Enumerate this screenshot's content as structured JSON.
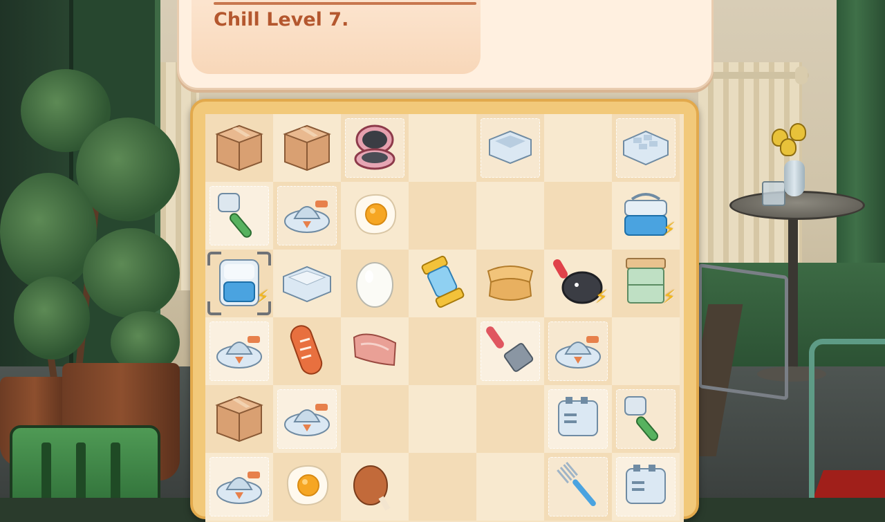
{
  "dialog": {
    "text": "Chill Level 7."
  },
  "board": {
    "rows": [
      [
        {
          "item": "cardboard-box",
          "icon": "box-icon"
        },
        {
          "item": "cardboard-box",
          "icon": "box-icon"
        },
        {
          "item": "waffle-maker",
          "icon": "waffle-maker-icon",
          "bubble": true
        },
        {
          "item": "empty"
        },
        {
          "item": "ice-tray",
          "icon": "ice-tray-icon",
          "bubble": true
        },
        {
          "item": "empty"
        },
        {
          "item": "ice-cube-tray",
          "icon": "ice-cube-tray-icon",
          "bubble": true
        }
      ],
      [
        {
          "item": "meat-tenderizer",
          "icon": "mallet-icon",
          "bubble": true
        },
        {
          "item": "juicer",
          "icon": "juicer-icon",
          "bubble": true
        },
        {
          "item": "fried-egg",
          "icon": "fried-egg-icon"
        },
        {
          "item": "empty"
        },
        {
          "item": "empty"
        },
        {
          "item": "empty"
        },
        {
          "item": "cooler-box",
          "icon": "cooler-icon",
          "energy": true
        }
      ],
      [
        {
          "item": "mini-fridge",
          "icon": "mini-fridge-icon",
          "energy": true,
          "selected": true
        },
        {
          "item": "container",
          "icon": "container-icon"
        },
        {
          "item": "egg",
          "icon": "egg-icon"
        },
        {
          "item": "blender-jar",
          "icon": "blender-jar-icon"
        },
        {
          "item": "crepe",
          "icon": "crepe-icon"
        },
        {
          "item": "frying-pan",
          "icon": "frying-pan-icon",
          "energy": true
        },
        {
          "item": "cabinet",
          "icon": "cabinet-icon",
          "energy": true
        }
      ],
      [
        {
          "item": "juicer",
          "icon": "juicer-icon",
          "bubble": true
        },
        {
          "item": "sausage",
          "icon": "sausage-icon"
        },
        {
          "item": "bacon",
          "icon": "bacon-icon"
        },
        {
          "item": "empty"
        },
        {
          "item": "spatula",
          "icon": "spatula-icon",
          "bubble": true
        },
        {
          "item": "juicer",
          "icon": "juicer-icon",
          "bubble": true
        },
        {
          "item": "empty"
        }
      ],
      [
        {
          "item": "cardboard-box",
          "icon": "box-icon"
        },
        {
          "item": "juicer",
          "icon": "juicer-icon",
          "bubble": true
        },
        {
          "item": "empty"
        },
        {
          "item": "empty"
        },
        {
          "item": "empty"
        },
        {
          "item": "toaster",
          "icon": "toaster-icon",
          "bubble": true
        },
        {
          "item": "meat-tenderizer",
          "icon": "mallet-icon",
          "bubble": true
        }
      ],
      [
        {
          "item": "juicer",
          "icon": "juicer-icon",
          "bubble": true
        },
        {
          "item": "fried-egg",
          "icon": "fried-egg-icon"
        },
        {
          "item": "chicken-leg",
          "icon": "chicken-leg-icon"
        },
        {
          "item": "empty"
        },
        {
          "item": "empty"
        },
        {
          "item": "fork",
          "icon": "fork-icon",
          "bubble": true
        },
        {
          "item": "toaster",
          "icon": "toaster-icon",
          "bubble": true
        }
      ]
    ]
  },
  "colors": {
    "accent_text": "#b4572e",
    "board_frame": "#f2c97a",
    "energy": "#f4b81d"
  }
}
